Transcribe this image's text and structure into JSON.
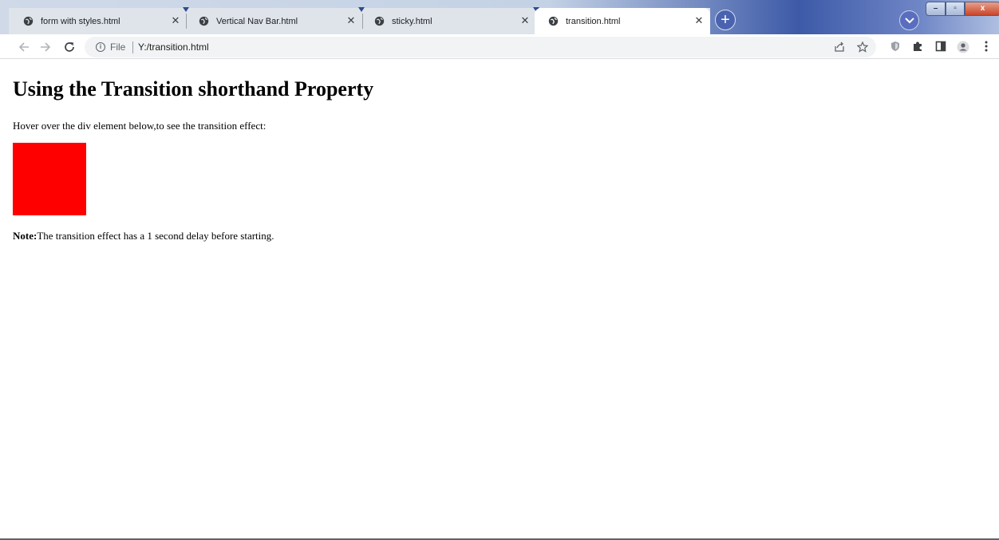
{
  "browser": {
    "tabs": [
      {
        "label": "form with styles.html",
        "close": "✕"
      },
      {
        "label": "Vertical Nav Bar.html",
        "close": "✕"
      },
      {
        "label": "sticky.html",
        "close": "✕"
      },
      {
        "label": "transition.html",
        "close": "✕",
        "active": true
      }
    ],
    "new_tab_label": "+",
    "window_controls": {
      "minimize": "–",
      "maximize": "▫",
      "close": "x"
    },
    "omnibox": {
      "scheme_label": "File",
      "url": "Y:/transition.html"
    }
  },
  "page": {
    "heading": "Using the Transition shorthand Property",
    "intro": "Hover over the div element below,to see the transition effect:",
    "demo_box_color": "#ff0000",
    "note_label": "Note:",
    "note_text": "The transition effect has a 1 second delay before starting."
  },
  "colors": {
    "tab_strip": "#dfe3ea",
    "omnibox_bg": "#f1f3f4",
    "titlebar_accent": "#3d5aa8"
  }
}
